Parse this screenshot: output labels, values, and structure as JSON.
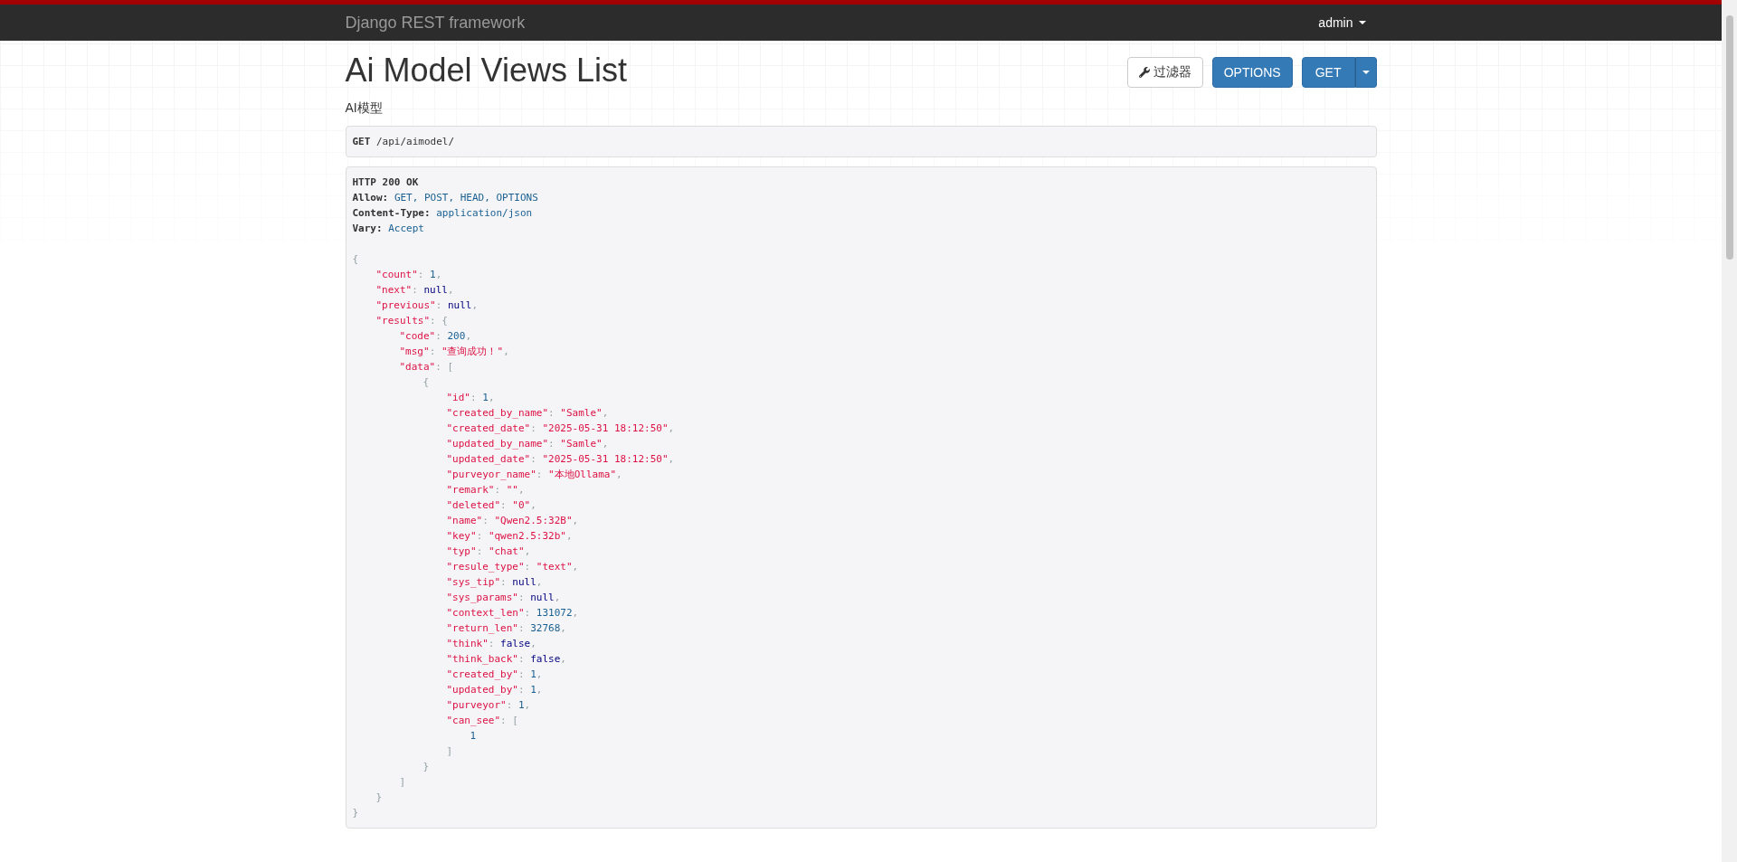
{
  "navbar": {
    "brand": "Django REST framework",
    "user": "admin"
  },
  "page": {
    "title": "Ai Model Views List",
    "description": "AI模型"
  },
  "buttons": [
    {
      "kind": "filter",
      "label": "过滤器"
    },
    {
      "kind": "primary",
      "label": "OPTIONS"
    },
    {
      "kind": "split",
      "label": "GET"
    }
  ],
  "request": {
    "method": "GET",
    "path": "/api/aimodel/"
  },
  "response": {
    "status": "HTTP 200 OK",
    "headers": [
      {
        "name": "Allow:",
        "value": "GET, POST, HEAD, OPTIONS"
      },
      {
        "name": "Content-Type:",
        "value": "application/json"
      },
      {
        "name": "Vary:",
        "value": "Accept"
      }
    ],
    "body": {
      "tokens": [
        {
          "kind": "pun",
          "text": "{"
        }
      ],
      "children": [
        {
          "tokens": [
            {
              "kind": "key",
              "text": "\"count\""
            },
            {
              "kind": "pun",
              "text": ": "
            },
            {
              "kind": "num",
              "text": "1"
            },
            {
              "kind": "pun",
              "text": ","
            }
          ]
        },
        {
          "tokens": [
            {
              "kind": "key",
              "text": "\"next\""
            },
            {
              "kind": "pun",
              "text": ": "
            },
            {
              "kind": "lit",
              "text": "null"
            },
            {
              "kind": "pun",
              "text": ","
            }
          ]
        },
        {
          "tokens": [
            {
              "kind": "key",
              "text": "\"previous\""
            },
            {
              "kind": "pun",
              "text": ": "
            },
            {
              "kind": "lit",
              "text": "null"
            },
            {
              "kind": "pun",
              "text": ","
            }
          ]
        },
        {
          "tokens": [
            {
              "kind": "key",
              "text": "\"results\""
            },
            {
              "kind": "pun",
              "text": ": {"
            }
          ],
          "children": [
            {
              "tokens": [
                {
                  "kind": "key",
                  "text": "\"code\""
                },
                {
                  "kind": "pun",
                  "text": ": "
                },
                {
                  "kind": "num",
                  "text": "200"
                },
                {
                  "kind": "pun",
                  "text": ","
                }
              ]
            },
            {
              "tokens": [
                {
                  "kind": "key",
                  "text": "\"msg\""
                },
                {
                  "kind": "pun",
                  "text": ": "
                },
                {
                  "kind": "str",
                  "text": "\"查询成功！\""
                },
                {
                  "kind": "pun",
                  "text": ","
                }
              ]
            },
            {
              "tokens": [
                {
                  "kind": "key",
                  "text": "\"data\""
                },
                {
                  "kind": "pun",
                  "text": ": ["
                }
              ],
              "children": [
                {
                  "tokens": [
                    {
                      "kind": "pun",
                      "text": "{"
                    }
                  ],
                  "children": [
                    {
                      "tokens": [
                        {
                          "kind": "key",
                          "text": "\"id\""
                        },
                        {
                          "kind": "pun",
                          "text": ": "
                        },
                        {
                          "kind": "num",
                          "text": "1"
                        },
                        {
                          "kind": "pun",
                          "text": ","
                        }
                      ]
                    },
                    {
                      "tokens": [
                        {
                          "kind": "key",
                          "text": "\"created_by_name\""
                        },
                        {
                          "kind": "pun",
                          "text": ": "
                        },
                        {
                          "kind": "str",
                          "text": "\"Samle\""
                        },
                        {
                          "kind": "pun",
                          "text": ","
                        }
                      ]
                    },
                    {
                      "tokens": [
                        {
                          "kind": "key",
                          "text": "\"created_date\""
                        },
                        {
                          "kind": "pun",
                          "text": ": "
                        },
                        {
                          "kind": "str",
                          "text": "\"2025-05-31 18:12:50\""
                        },
                        {
                          "kind": "pun",
                          "text": ","
                        }
                      ]
                    },
                    {
                      "tokens": [
                        {
                          "kind": "key",
                          "text": "\"updated_by_name\""
                        },
                        {
                          "kind": "pun",
                          "text": ": "
                        },
                        {
                          "kind": "str",
                          "text": "\"Samle\""
                        },
                        {
                          "kind": "pun",
                          "text": ","
                        }
                      ]
                    },
                    {
                      "tokens": [
                        {
                          "kind": "key",
                          "text": "\"updated_date\""
                        },
                        {
                          "kind": "pun",
                          "text": ": "
                        },
                        {
                          "kind": "str",
                          "text": "\"2025-05-31 18:12:50\""
                        },
                        {
                          "kind": "pun",
                          "text": ","
                        }
                      ]
                    },
                    {
                      "tokens": [
                        {
                          "kind": "key",
                          "text": "\"purveyor_name\""
                        },
                        {
                          "kind": "pun",
                          "text": ": "
                        },
                        {
                          "kind": "str",
                          "text": "\"本地Ollama\""
                        },
                        {
                          "kind": "pun",
                          "text": ","
                        }
                      ]
                    },
                    {
                      "tokens": [
                        {
                          "kind": "key",
                          "text": "\"remark\""
                        },
                        {
                          "kind": "pun",
                          "text": ": "
                        },
                        {
                          "kind": "str",
                          "text": "\"\""
                        },
                        {
                          "kind": "pun",
                          "text": ","
                        }
                      ]
                    },
                    {
                      "tokens": [
                        {
                          "kind": "key",
                          "text": "\"deleted\""
                        },
                        {
                          "kind": "pun",
                          "text": ": "
                        },
                        {
                          "kind": "str",
                          "text": "\"0\""
                        },
                        {
                          "kind": "pun",
                          "text": ","
                        }
                      ]
                    },
                    {
                      "tokens": [
                        {
                          "kind": "key",
                          "text": "\"name\""
                        },
                        {
                          "kind": "pun",
                          "text": ": "
                        },
                        {
                          "kind": "str",
                          "text": "\"Qwen2.5:32B\""
                        },
                        {
                          "kind": "pun",
                          "text": ","
                        }
                      ]
                    },
                    {
                      "tokens": [
                        {
                          "kind": "key",
                          "text": "\"key\""
                        },
                        {
                          "kind": "pun",
                          "text": ": "
                        },
                        {
                          "kind": "str",
                          "text": "\"qwen2.5:32b\""
                        },
                        {
                          "kind": "pun",
                          "text": ","
                        }
                      ]
                    },
                    {
                      "tokens": [
                        {
                          "kind": "key",
                          "text": "\"typ\""
                        },
                        {
                          "kind": "pun",
                          "text": ": "
                        },
                        {
                          "kind": "str",
                          "text": "\"chat\""
                        },
                        {
                          "kind": "pun",
                          "text": ","
                        }
                      ]
                    },
                    {
                      "tokens": [
                        {
                          "kind": "key",
                          "text": "\"resule_type\""
                        },
                        {
                          "kind": "pun",
                          "text": ": "
                        },
                        {
                          "kind": "str",
                          "text": "\"text\""
                        },
                        {
                          "kind": "pun",
                          "text": ","
                        }
                      ]
                    },
                    {
                      "tokens": [
                        {
                          "kind": "key",
                          "text": "\"sys_tip\""
                        },
                        {
                          "kind": "pun",
                          "text": ": "
                        },
                        {
                          "kind": "lit",
                          "text": "null"
                        },
                        {
                          "kind": "pun",
                          "text": ","
                        }
                      ]
                    },
                    {
                      "tokens": [
                        {
                          "kind": "key",
                          "text": "\"sys_params\""
                        },
                        {
                          "kind": "pun",
                          "text": ": "
                        },
                        {
                          "kind": "lit",
                          "text": "null"
                        },
                        {
                          "kind": "pun",
                          "text": ","
                        }
                      ]
                    },
                    {
                      "tokens": [
                        {
                          "kind": "key",
                          "text": "\"context_len\""
                        },
                        {
                          "kind": "pun",
                          "text": ": "
                        },
                        {
                          "kind": "num",
                          "text": "131072"
                        },
                        {
                          "kind": "pun",
                          "text": ","
                        }
                      ]
                    },
                    {
                      "tokens": [
                        {
                          "kind": "key",
                          "text": "\"return_len\""
                        },
                        {
                          "kind": "pun",
                          "text": ": "
                        },
                        {
                          "kind": "num",
                          "text": "32768"
                        },
                        {
                          "kind": "pun",
                          "text": ","
                        }
                      ]
                    },
                    {
                      "tokens": [
                        {
                          "kind": "key",
                          "text": "\"think\""
                        },
                        {
                          "kind": "pun",
                          "text": ": "
                        },
                        {
                          "kind": "lit",
                          "text": "false"
                        },
                        {
                          "kind": "pun",
                          "text": ","
                        }
                      ]
                    },
                    {
                      "tokens": [
                        {
                          "kind": "key",
                          "text": "\"think_back\""
                        },
                        {
                          "kind": "pun",
                          "text": ": "
                        },
                        {
                          "kind": "lit",
                          "text": "false"
                        },
                        {
                          "kind": "pun",
                          "text": ","
                        }
                      ]
                    },
                    {
                      "tokens": [
                        {
                          "kind": "key",
                          "text": "\"created_by\""
                        },
                        {
                          "kind": "pun",
                          "text": ": "
                        },
                        {
                          "kind": "num",
                          "text": "1"
                        },
                        {
                          "kind": "pun",
                          "text": ","
                        }
                      ]
                    },
                    {
                      "tokens": [
                        {
                          "kind": "key",
                          "text": "\"updated_by\""
                        },
                        {
                          "kind": "pun",
                          "text": ": "
                        },
                        {
                          "kind": "num",
                          "text": "1"
                        },
                        {
                          "kind": "pun",
                          "text": ","
                        }
                      ]
                    },
                    {
                      "tokens": [
                        {
                          "kind": "key",
                          "text": "\"purveyor\""
                        },
                        {
                          "kind": "pun",
                          "text": ": "
                        },
                        {
                          "kind": "num",
                          "text": "1"
                        },
                        {
                          "kind": "pun",
                          "text": ","
                        }
                      ]
                    },
                    {
                      "tokens": [
                        {
                          "kind": "key",
                          "text": "\"can_see\""
                        },
                        {
                          "kind": "pun",
                          "text": ": ["
                        }
                      ],
                      "children": [
                        {
                          "tokens": [
                            {
                              "kind": "num",
                              "text": "1"
                            }
                          ]
                        }
                      ],
                      "close": [
                        {
                          "kind": "pun",
                          "text": "]"
                        }
                      ]
                    }
                  ],
                  "close": [
                    {
                      "kind": "pun",
                      "text": "}"
                    }
                  ]
                }
              ],
              "close": [
                {
                  "kind": "pun",
                  "text": "]"
                }
              ]
            }
          ],
          "close": [
            {
              "kind": "pun",
              "text": "}"
            }
          ]
        }
      ],
      "close": [
        {
          "kind": "pun",
          "text": "}"
        }
      ]
    }
  }
}
